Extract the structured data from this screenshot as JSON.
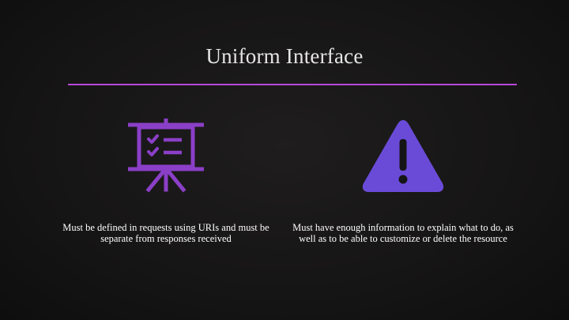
{
  "slide": {
    "title": "Uniform Interface",
    "accent_color": "#b748d9",
    "left_item": {
      "icon": "presentation-checklist-icon",
      "icon_color": "#8b3fc7",
      "caption": "Must be defined in requests using URIs and must be separate from responses received"
    },
    "right_item": {
      "icon": "warning-icon",
      "icon_color": "#6a4bd8",
      "caption": "Must have enough information to explain what to do, as well as to be able to customize or delete the resource"
    }
  }
}
